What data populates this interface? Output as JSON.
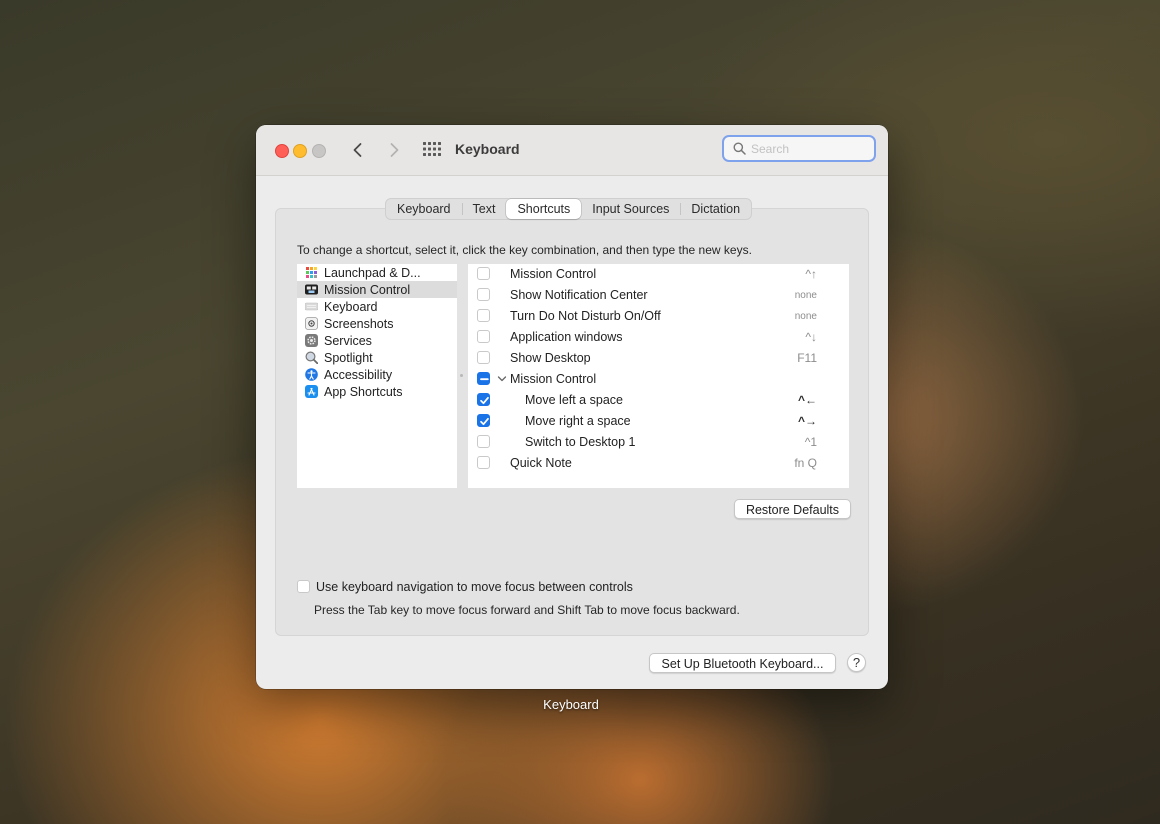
{
  "window": {
    "title": "Keyboard",
    "search_placeholder": "Search"
  },
  "tabs": [
    {
      "label": "Keyboard",
      "selected": false
    },
    {
      "label": "Text",
      "selected": false
    },
    {
      "label": "Shortcuts",
      "selected": true
    },
    {
      "label": "Input Sources",
      "selected": false
    },
    {
      "label": "Dictation",
      "selected": false
    }
  ],
  "instructions": "To change a shortcut, select it, click the key combination, and then type the new keys.",
  "categories": [
    {
      "label": "Launchpad & D...",
      "icon": "launchpad-icon"
    },
    {
      "label": "Mission Control",
      "icon": "mission-control-icon",
      "selected": true
    },
    {
      "label": "Keyboard",
      "icon": "keyboard-icon"
    },
    {
      "label": "Screenshots",
      "icon": "screenshot-icon"
    },
    {
      "label": "Services",
      "icon": "gear-icon"
    },
    {
      "label": "Spotlight",
      "icon": "spotlight-icon"
    },
    {
      "label": "Accessibility",
      "icon": "accessibility-icon"
    },
    {
      "label": "App Shortcuts",
      "icon": "app-store-icon"
    }
  ],
  "shortcuts": [
    {
      "label": "Mission Control",
      "key": "^↑",
      "checked": false
    },
    {
      "label": "Show Notification Center",
      "key": "none",
      "checked": false
    },
    {
      "label": "Turn Do Not Disturb On/Off",
      "key": "none",
      "checked": false
    },
    {
      "label": "Application windows",
      "key": "^↓",
      "checked": false
    },
    {
      "label": "Show Desktop",
      "key": "F11",
      "checked": false
    },
    {
      "label": "Mission Control",
      "key": "",
      "state": "mixed",
      "group": true
    },
    {
      "label": "Move left a space",
      "key": "^←",
      "checked": true,
      "indent": true
    },
    {
      "label": "Move right a space",
      "key": "^→",
      "checked": true,
      "indent": true
    },
    {
      "label": "Switch to Desktop 1",
      "key": "^1",
      "checked": false,
      "indent": true
    },
    {
      "label": "Quick Note",
      "key": "fn Q",
      "checked": false
    }
  ],
  "restore_defaults": "Restore Defaults",
  "keyboard_nav": {
    "label": "Use keyboard navigation to move focus between controls",
    "help": "Press the Tab key to move focus forward and Shift Tab to move focus backward.",
    "checked": false
  },
  "bluetooth_button": "Set Up Bluetooth Keyboard...",
  "help_button": "?",
  "dock_label": "Keyboard"
}
